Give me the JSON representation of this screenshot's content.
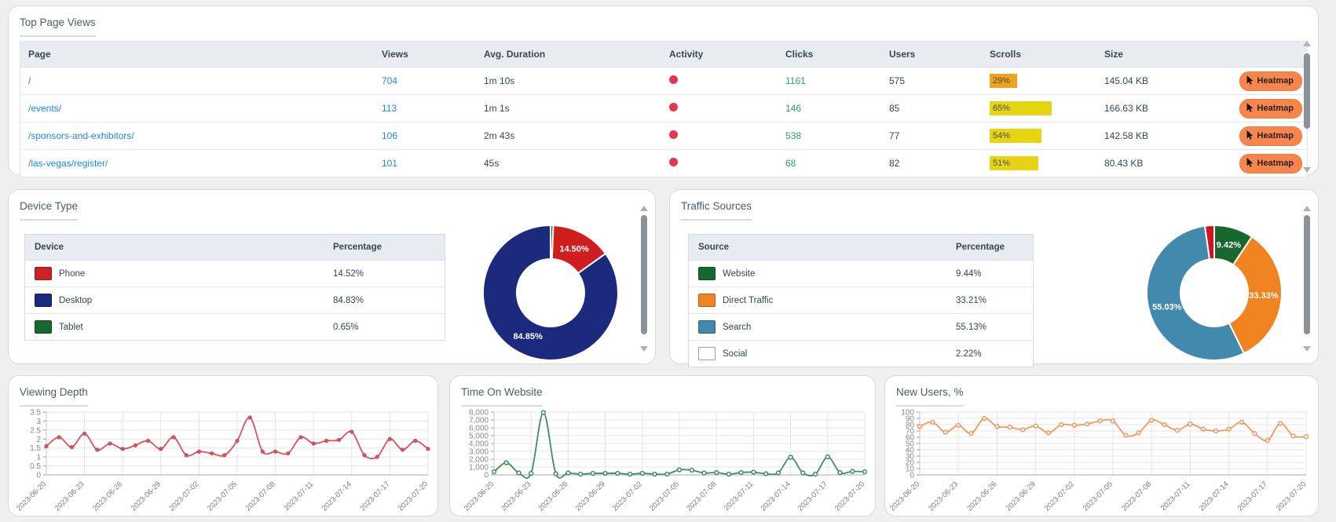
{
  "colors": {
    "link": "#1e88e5",
    "clicks_green": "#27a768",
    "activity_red": "#e8354b",
    "cell_text": "#37474f",
    "scroll_orange": "#f0a41c",
    "scroll_yellow": "#e7d413",
    "heatmap_pill": "#f6864e"
  },
  "top_page_views": {
    "title": "Top Page Views",
    "columns": [
      "Page",
      "Views",
      "Avg. Duration",
      "Activity",
      "Clicks",
      "Users",
      "Scrolls",
      "Size"
    ],
    "rows": [
      {
        "page": "/",
        "views": "704",
        "avg_duration": "1m 10s",
        "clicks": "1161",
        "users": "575",
        "scrolls_pct": 29,
        "scrolls_label": "29%",
        "scrolls_color": "#f0a41c",
        "size": "145.04 KB",
        "heatmap_label": "Heatmap"
      },
      {
        "page": "/events/",
        "views": "113",
        "avg_duration": "1m 1s",
        "clicks": "146",
        "users": "85",
        "scrolls_pct": 65,
        "scrolls_label": "65%",
        "scrolls_color": "#e7d413",
        "size": "166.63 KB",
        "heatmap_label": "Heatmap"
      },
      {
        "page": "/sponsors-and-exhibitors/",
        "views": "106",
        "avg_duration": "2m 43s",
        "clicks": "538",
        "users": "77",
        "scrolls_pct": 54,
        "scrolls_label": "54%",
        "scrolls_color": "#e7d413",
        "size": "142.58 KB",
        "heatmap_label": "Heatmap"
      },
      {
        "page": "/las-vegas/register/",
        "views": "101",
        "avg_duration": "45s",
        "clicks": "68",
        "users": "82",
        "scrolls_pct": 51,
        "scrolls_label": "51%",
        "scrolls_color": "#e7d413",
        "size": "80.43 KB",
        "heatmap_label": "Heatmap"
      }
    ]
  },
  "device_type": {
    "title": "Device Type",
    "columns": [
      "Device",
      "Percentage"
    ],
    "rows": [
      {
        "label": "Phone",
        "color": "#cc2127",
        "percentage": "14.52%"
      },
      {
        "label": "Desktop",
        "color": "#1b2a7c",
        "percentage": "84.83%"
      },
      {
        "label": "Tablet",
        "color": "#17672f",
        "percentage": "0.65%"
      }
    ]
  },
  "traffic_sources": {
    "title": "Traffic Sources",
    "columns": [
      "Source",
      "Percentage"
    ],
    "rows": [
      {
        "label": "Website",
        "color": "#17672f",
        "percentage": "9.44%"
      },
      {
        "label": "Direct Traffic",
        "color": "#f08420",
        "percentage": "33.21%"
      },
      {
        "label": "Search",
        "color": "#4289ae",
        "percentage": "55.13%"
      },
      {
        "label": "Social",
        "color": "#ffffff",
        "percentage": "2.22%"
      }
    ]
  },
  "chart_data": [
    {
      "type": "pie",
      "name": "device-donut",
      "slices": [
        {
          "label": "Tablet",
          "value": 0.65,
          "color": "#17672f",
          "text": ""
        },
        {
          "label": "Phone",
          "value": 14.5,
          "color": "#cf1d20",
          "text": "14.50%"
        },
        {
          "label": "Desktop",
          "value": 84.85,
          "color": "#1b2a7c",
          "text": "84.85%"
        }
      ]
    },
    {
      "type": "pie",
      "name": "traffic-donut",
      "slices": [
        {
          "label": "Website",
          "value": 9.42,
          "color": "#17672f",
          "text": "9.42%"
        },
        {
          "label": "Direct Traffic",
          "value": 33.33,
          "color": "#f08420",
          "text": "33.33%"
        },
        {
          "label": "Search",
          "value": 55.03,
          "color": "#4289ae",
          "text": "55.03%"
        },
        {
          "label": "Social",
          "value": 2.22,
          "color": "#d8101e",
          "text": ""
        }
      ]
    },
    {
      "type": "line",
      "title": "Viewing Depth",
      "color": "#e0515e",
      "marker": "solid",
      "ylim": [
        0,
        3.5
      ],
      "yticks": [
        "0",
        "0.5",
        "1",
        "1.5",
        "2",
        "2.5",
        "3",
        "3.5"
      ],
      "label_every": 3,
      "x": [
        "2023-06-20",
        "2023-06-21",
        "2023-06-22",
        "2023-06-23",
        "2023-06-24",
        "2023-06-25",
        "2023-06-26",
        "2023-06-27",
        "2023-06-28",
        "2023-06-29",
        "2023-06-30",
        "2023-07-01",
        "2023-07-02",
        "2023-07-03",
        "2023-07-04",
        "2023-07-05",
        "2023-07-06",
        "2023-07-07",
        "2023-07-08",
        "2023-07-09",
        "2023-07-10",
        "2023-07-11",
        "2023-07-12",
        "2023-07-13",
        "2023-07-14",
        "2023-07-15",
        "2023-07-16",
        "2023-07-17",
        "2023-07-18",
        "2023-07-19",
        "2023-07-20"
      ],
      "values": [
        1.6,
        2.1,
        1.55,
        2.3,
        1.4,
        1.75,
        1.45,
        1.65,
        1.9,
        1.45,
        2.1,
        1.1,
        1.3,
        1.2,
        1.1,
        1.9,
        3.2,
        1.3,
        1.3,
        1.2,
        2.1,
        1.75,
        1.9,
        1.95,
        2.4,
        1.1,
        1.0,
        2.0,
        1.4,
        1.9,
        1.45
      ]
    },
    {
      "type": "line",
      "title": "Time On Website",
      "color": "#3f8e5f",
      "marker": "ring",
      "ylim": [
        0,
        8000
      ],
      "yticks": [
        "0",
        "1,000",
        "2,000",
        "3,000",
        "4,000",
        "5,000",
        "6,000",
        "7,000",
        "8,000"
      ],
      "label_every": 3,
      "x": [
        "2023-06-20",
        "2023-06-21",
        "2023-06-22",
        "2023-06-23",
        "2023-06-24",
        "2023-06-25",
        "2023-06-26",
        "2023-06-27",
        "2023-06-28",
        "2023-06-29",
        "2023-06-30",
        "2023-07-01",
        "2023-07-02",
        "2023-07-03",
        "2023-07-04",
        "2023-07-05",
        "2023-07-06",
        "2023-07-07",
        "2023-07-08",
        "2023-07-09",
        "2023-07-10",
        "2023-07-11",
        "2023-07-12",
        "2023-07-13",
        "2023-07-14",
        "2023-07-15",
        "2023-07-16",
        "2023-07-17",
        "2023-07-18",
        "2023-07-19",
        "2023-07-20"
      ],
      "values": [
        400,
        1550,
        250,
        200,
        7950,
        150,
        250,
        100,
        200,
        200,
        200,
        100,
        200,
        100,
        100,
        650,
        600,
        250,
        300,
        100,
        300,
        350,
        150,
        250,
        2250,
        250,
        100,
        2300,
        300,
        450,
        400
      ]
    },
    {
      "type": "line",
      "title": "New Users, %",
      "color": "#f5975a",
      "marker": "ring",
      "ylim": [
        0,
        100
      ],
      "yticks": [
        "0",
        "10",
        "20",
        "30",
        "40",
        "50",
        "60",
        "70",
        "80",
        "90",
        "100"
      ],
      "label_every": 3,
      "x": [
        "2023-06-20",
        "2023-06-21",
        "2023-06-22",
        "2023-06-23",
        "2023-06-24",
        "2023-06-25",
        "2023-06-26",
        "2023-06-27",
        "2023-06-28",
        "2023-06-29",
        "2023-06-30",
        "2023-07-01",
        "2023-07-02",
        "2023-07-03",
        "2023-07-04",
        "2023-07-05",
        "2023-07-06",
        "2023-07-07",
        "2023-07-08",
        "2023-07-09",
        "2023-07-10",
        "2023-07-11",
        "2023-07-12",
        "2023-07-13",
        "2023-07-14",
        "2023-07-15",
        "2023-07-16",
        "2023-07-17",
        "2023-07-18",
        "2023-07-19",
        "2023-07-20"
      ],
      "values": [
        77,
        84,
        68,
        79,
        66,
        90,
        77,
        76,
        72,
        78,
        67,
        80,
        79,
        81,
        86,
        86,
        63,
        67,
        87,
        80,
        71,
        81,
        73,
        70,
        73,
        84,
        66,
        55,
        82,
        62,
        61
      ]
    }
  ]
}
